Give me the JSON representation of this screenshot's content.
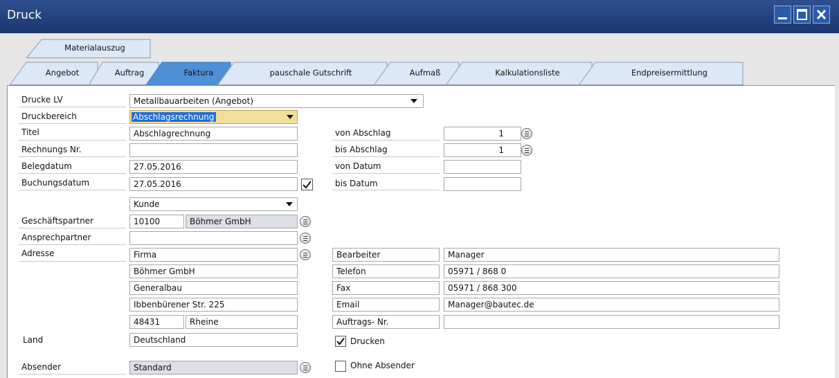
{
  "window": {
    "title": "Druck"
  },
  "tabs": {
    "top": {
      "label": "Materialauszug"
    },
    "bottom": [
      {
        "label": "Angebot"
      },
      {
        "label": "Auftrag"
      },
      {
        "label": "Faktura"
      },
      {
        "label": "pauschale Gutschrift"
      },
      {
        "label": "Aufmaß"
      },
      {
        "label": "Kalkulationsliste"
      },
      {
        "label": "Endpreisermittlung"
      }
    ],
    "active": "Faktura"
  },
  "form": {
    "drucke_lv": {
      "label": "Drucke LV",
      "value": "Metallbauarbeiten (Angebot)"
    },
    "druckbereich": {
      "label": "Druckbereich",
      "value": "Abschlagsrechnung"
    },
    "titel": {
      "label": "Titel",
      "value": "Abschlagrechnung"
    },
    "rechnungs_nr": {
      "label": "Rechnungs Nr.",
      "value": ""
    },
    "belegdatum": {
      "label": "Belegdatum",
      "value": "27.05.2016"
    },
    "buchungsdatum": {
      "label": "Buchungsdatum",
      "value": "27.05.2016",
      "checked": true
    },
    "von_abschlag": {
      "label": "von Abschlag",
      "value": "1"
    },
    "bis_abschlag": {
      "label": "bis Abschlag",
      "value": "1"
    },
    "von_datum": {
      "label": "von Datum",
      "value": ""
    },
    "bis_datum": {
      "label": "bis Datum",
      "value": ""
    },
    "partner_type": {
      "value": "Kunde"
    },
    "geschaeftspartner": {
      "label": "Geschäftspartner",
      "code": "10100",
      "name": "Böhmer GmbH"
    },
    "ansprechpartner": {
      "label": "Ansprechpartner",
      "value": ""
    },
    "adresse": {
      "label": "Adresse",
      "line1": "Firma",
      "line2": "Böhmer GmbH",
      "line3": "Generalbau",
      "line4": "Ibbenbürener Str. 225",
      "plz": "48431",
      "ort": "Rheine"
    },
    "land": {
      "label": "Land",
      "value": "Deutschland"
    },
    "absender": {
      "label": "Absender",
      "value": "Standard"
    },
    "bearbeiter": {
      "label": "Bearbeiter",
      "value": "Manager"
    },
    "telefon": {
      "label": "Telefon",
      "value": "05971 / 868 0"
    },
    "fax": {
      "label": "Fax",
      "value": "05971 / 868 300"
    },
    "email": {
      "label": "Email",
      "value": "Manager@bautec.de"
    },
    "auftrags_nr": {
      "label": "Auftrags- Nr.",
      "value": ""
    },
    "drucken": {
      "label": "Drucken",
      "checked": true
    },
    "ohne_absender": {
      "label": "Ohne Absender",
      "checked": false
    }
  },
  "colors": {
    "titlebar": "#1c3670",
    "active_tab": "#4f8fd8",
    "tab": "#dce8f8",
    "highlight": "#1f6ed6",
    "dropdown_focus": "#f4df9a"
  },
  "icons": [
    "minimize-icon",
    "maximize-icon",
    "close-icon",
    "lookup-icon",
    "dropdown-arrow-icon",
    "checkmark-icon"
  ]
}
